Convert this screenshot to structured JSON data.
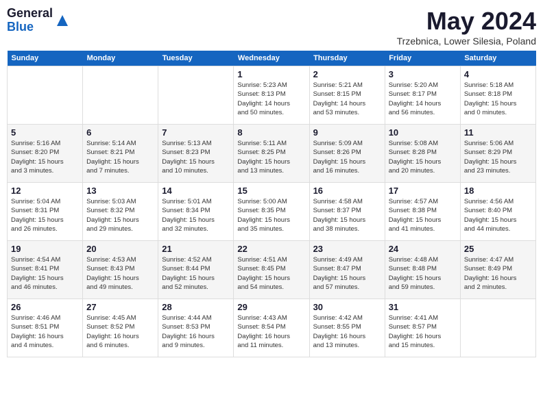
{
  "header": {
    "logo_general": "General",
    "logo_blue": "Blue",
    "month_title": "May 2024",
    "location": "Trzebnica, Lower Silesia, Poland"
  },
  "weekdays": [
    "Sunday",
    "Monday",
    "Tuesday",
    "Wednesday",
    "Thursday",
    "Friday",
    "Saturday"
  ],
  "weeks": [
    [
      {
        "day": "",
        "info": ""
      },
      {
        "day": "",
        "info": ""
      },
      {
        "day": "",
        "info": ""
      },
      {
        "day": "1",
        "info": "Sunrise: 5:23 AM\nSunset: 8:13 PM\nDaylight: 14 hours\nand 50 minutes."
      },
      {
        "day": "2",
        "info": "Sunrise: 5:21 AM\nSunset: 8:15 PM\nDaylight: 14 hours\nand 53 minutes."
      },
      {
        "day": "3",
        "info": "Sunrise: 5:20 AM\nSunset: 8:17 PM\nDaylight: 14 hours\nand 56 minutes."
      },
      {
        "day": "4",
        "info": "Sunrise: 5:18 AM\nSunset: 8:18 PM\nDaylight: 15 hours\nand 0 minutes."
      }
    ],
    [
      {
        "day": "5",
        "info": "Sunrise: 5:16 AM\nSunset: 8:20 PM\nDaylight: 15 hours\nand 3 minutes."
      },
      {
        "day": "6",
        "info": "Sunrise: 5:14 AM\nSunset: 8:21 PM\nDaylight: 15 hours\nand 7 minutes."
      },
      {
        "day": "7",
        "info": "Sunrise: 5:13 AM\nSunset: 8:23 PM\nDaylight: 15 hours\nand 10 minutes."
      },
      {
        "day": "8",
        "info": "Sunrise: 5:11 AM\nSunset: 8:25 PM\nDaylight: 15 hours\nand 13 minutes."
      },
      {
        "day": "9",
        "info": "Sunrise: 5:09 AM\nSunset: 8:26 PM\nDaylight: 15 hours\nand 16 minutes."
      },
      {
        "day": "10",
        "info": "Sunrise: 5:08 AM\nSunset: 8:28 PM\nDaylight: 15 hours\nand 20 minutes."
      },
      {
        "day": "11",
        "info": "Sunrise: 5:06 AM\nSunset: 8:29 PM\nDaylight: 15 hours\nand 23 minutes."
      }
    ],
    [
      {
        "day": "12",
        "info": "Sunrise: 5:04 AM\nSunset: 8:31 PM\nDaylight: 15 hours\nand 26 minutes."
      },
      {
        "day": "13",
        "info": "Sunrise: 5:03 AM\nSunset: 8:32 PM\nDaylight: 15 hours\nand 29 minutes."
      },
      {
        "day": "14",
        "info": "Sunrise: 5:01 AM\nSunset: 8:34 PM\nDaylight: 15 hours\nand 32 minutes."
      },
      {
        "day": "15",
        "info": "Sunrise: 5:00 AM\nSunset: 8:35 PM\nDaylight: 15 hours\nand 35 minutes."
      },
      {
        "day": "16",
        "info": "Sunrise: 4:58 AM\nSunset: 8:37 PM\nDaylight: 15 hours\nand 38 minutes."
      },
      {
        "day": "17",
        "info": "Sunrise: 4:57 AM\nSunset: 8:38 PM\nDaylight: 15 hours\nand 41 minutes."
      },
      {
        "day": "18",
        "info": "Sunrise: 4:56 AM\nSunset: 8:40 PM\nDaylight: 15 hours\nand 44 minutes."
      }
    ],
    [
      {
        "day": "19",
        "info": "Sunrise: 4:54 AM\nSunset: 8:41 PM\nDaylight: 15 hours\nand 46 minutes."
      },
      {
        "day": "20",
        "info": "Sunrise: 4:53 AM\nSunset: 8:43 PM\nDaylight: 15 hours\nand 49 minutes."
      },
      {
        "day": "21",
        "info": "Sunrise: 4:52 AM\nSunset: 8:44 PM\nDaylight: 15 hours\nand 52 minutes."
      },
      {
        "day": "22",
        "info": "Sunrise: 4:51 AM\nSunset: 8:45 PM\nDaylight: 15 hours\nand 54 minutes."
      },
      {
        "day": "23",
        "info": "Sunrise: 4:49 AM\nSunset: 8:47 PM\nDaylight: 15 hours\nand 57 minutes."
      },
      {
        "day": "24",
        "info": "Sunrise: 4:48 AM\nSunset: 8:48 PM\nDaylight: 15 hours\nand 59 minutes."
      },
      {
        "day": "25",
        "info": "Sunrise: 4:47 AM\nSunset: 8:49 PM\nDaylight: 16 hours\nand 2 minutes."
      }
    ],
    [
      {
        "day": "26",
        "info": "Sunrise: 4:46 AM\nSunset: 8:51 PM\nDaylight: 16 hours\nand 4 minutes."
      },
      {
        "day": "27",
        "info": "Sunrise: 4:45 AM\nSunset: 8:52 PM\nDaylight: 16 hours\nand 6 minutes."
      },
      {
        "day": "28",
        "info": "Sunrise: 4:44 AM\nSunset: 8:53 PM\nDaylight: 16 hours\nand 9 minutes."
      },
      {
        "day": "29",
        "info": "Sunrise: 4:43 AM\nSunset: 8:54 PM\nDaylight: 16 hours\nand 11 minutes."
      },
      {
        "day": "30",
        "info": "Sunrise: 4:42 AM\nSunset: 8:55 PM\nDaylight: 16 hours\nand 13 minutes."
      },
      {
        "day": "31",
        "info": "Sunrise: 4:41 AM\nSunset: 8:57 PM\nDaylight: 16 hours\nand 15 minutes."
      },
      {
        "day": "",
        "info": ""
      }
    ]
  ]
}
